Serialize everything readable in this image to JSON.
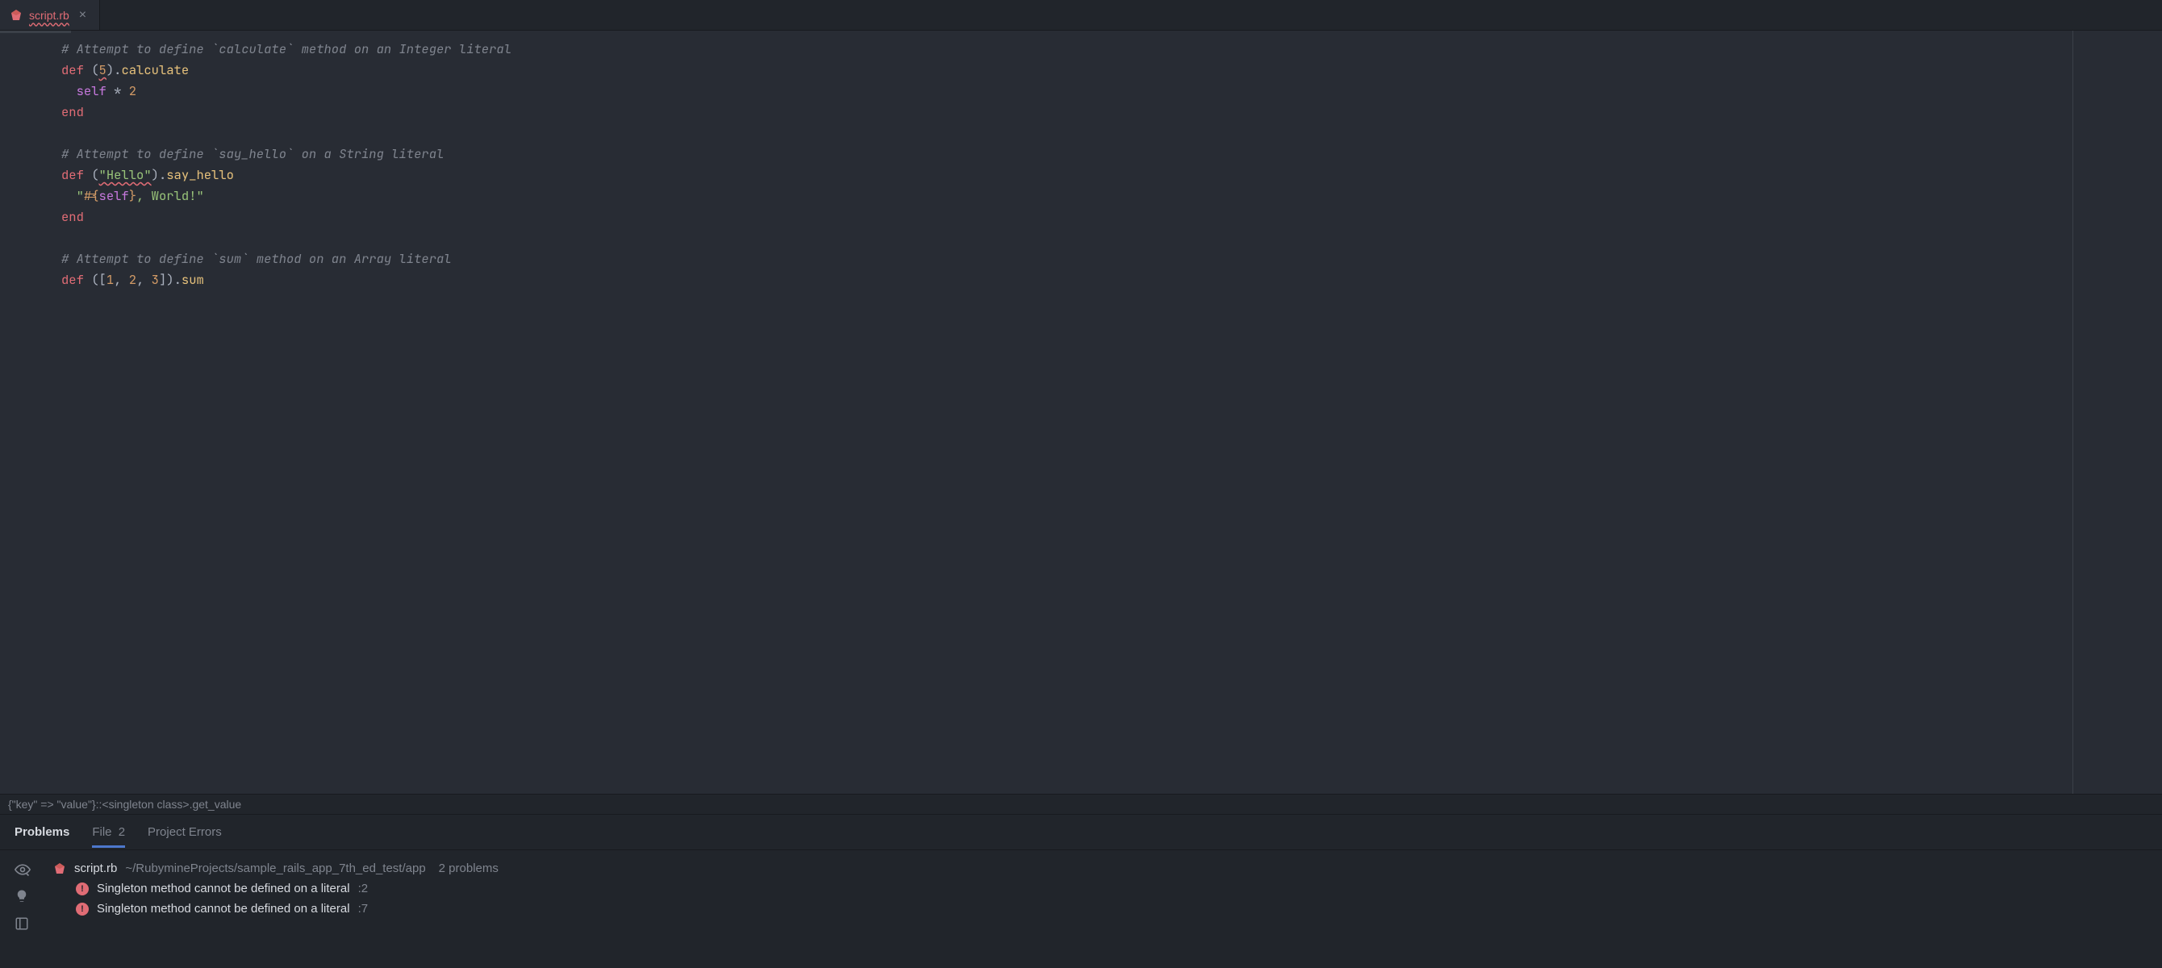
{
  "tab": {
    "filename": "script.rb"
  },
  "code": {
    "l1_comment": "# Attempt to define `calculate` method on an Integer literal",
    "l2_def": "def",
    "l2_lp": "(",
    "l2_lit": "5",
    "l2_rp": ").",
    "l2_method": "calculate",
    "l3_self": "self",
    "l3_op": " * ",
    "l3_num": "2",
    "l4_end": "end",
    "l6_comment": "# Attempt to define `say_hello` on a String literal",
    "l7_def": "def",
    "l7_lp": "(",
    "l7_lit": "\"Hello\"",
    "l7_rp": ").",
    "l7_method": "say_hello",
    "l8_q1": "\"",
    "l8_io": "#{",
    "l8_self": "self",
    "l8_ic": "}",
    "l8_rest": ", World!",
    "l8_q2": "\"",
    "l9_end": "end",
    "l11_comment": "# Attempt to define `sum` method on an Array literal",
    "l12_def": "def",
    "l12_lp": "([",
    "l12_n1": "1",
    "l12_c1": ", ",
    "l12_n2": "2",
    "l12_c2": ", ",
    "l12_n3": "3",
    "l12_rp": "]).",
    "l12_method": "sum"
  },
  "breadcrumb": "{\"key\" => \"value\"}::<singleton class>.get_value",
  "problems_tabs": {
    "problems": "Problems",
    "file": "File",
    "file_count": "2",
    "project_errors": "Project Errors"
  },
  "problems_file": {
    "name": "script.rb",
    "path": "~/RubymineProjects/sample_rails_app_7th_ed_test/app",
    "count": "2 problems"
  },
  "errors": [
    {
      "msg": "Singleton method cannot be defined on a literal",
      "line": ":2"
    },
    {
      "msg": "Singleton method cannot be defined on a literal",
      "line": ":7"
    }
  ]
}
